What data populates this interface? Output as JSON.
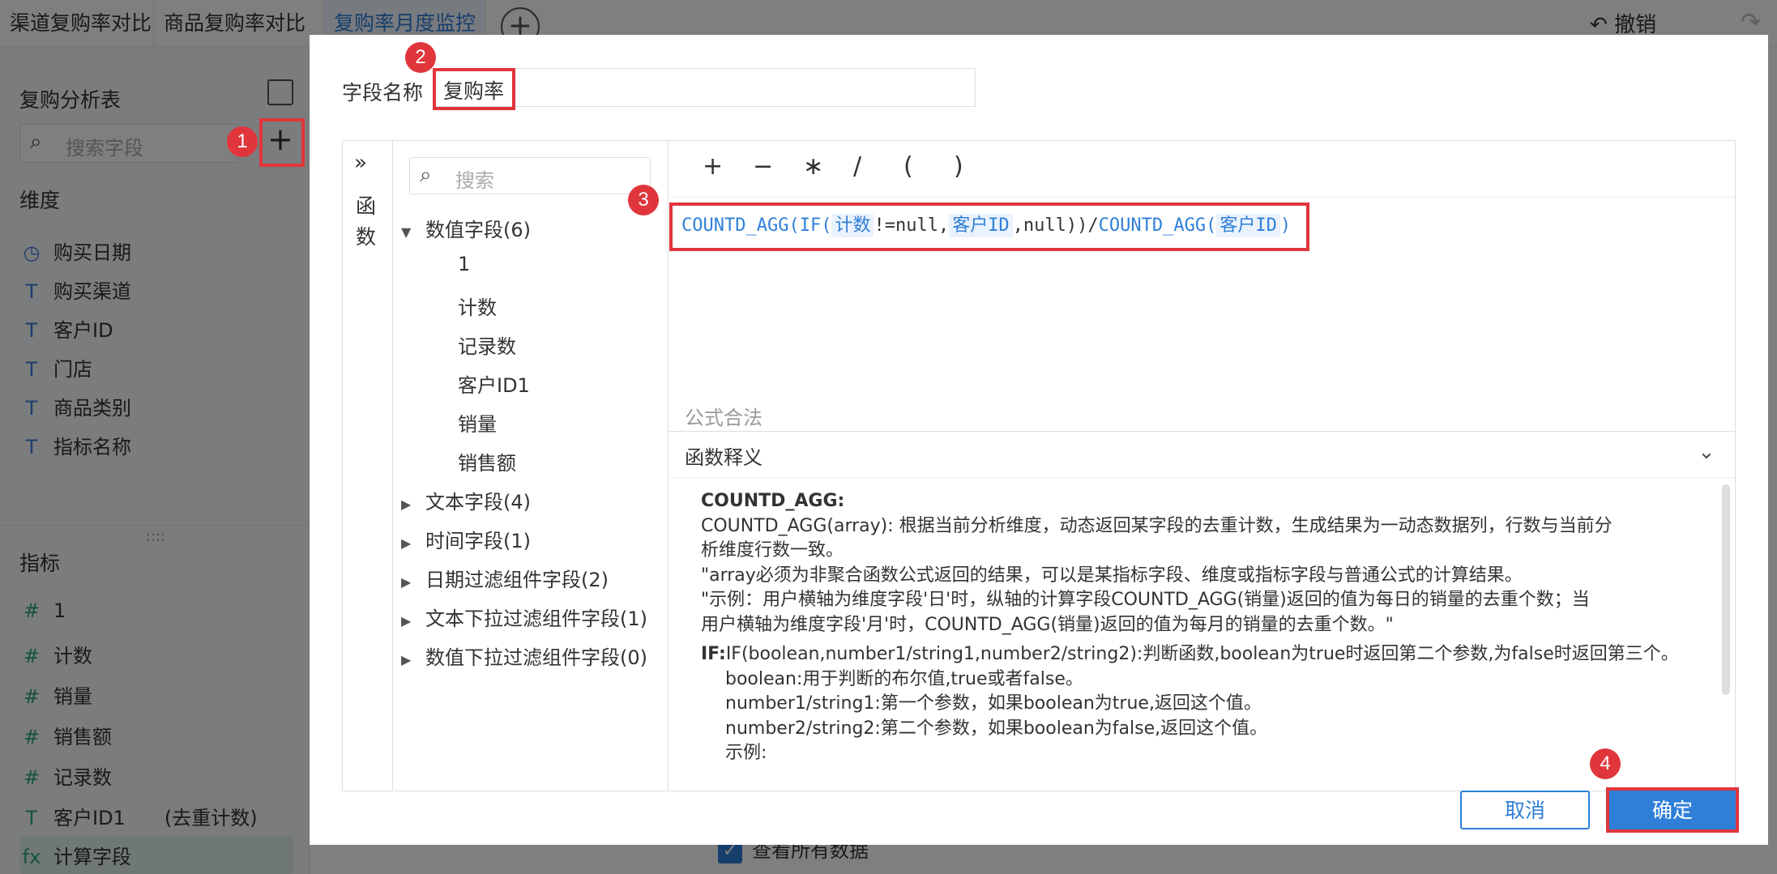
{
  "tabs": [
    "渠道复购率对比",
    "商品复购率对比",
    "复购率月度监控"
  ],
  "toolbar": {
    "undo_label": "撤销"
  },
  "sidebar": {
    "table_name": "复购分析表",
    "search_placeholder": "搜索字段",
    "dimension_title": "维度",
    "dimensions": [
      "购买日期",
      "购买渠道",
      "客户ID",
      "门店",
      "商品类别",
      "指标名称"
    ],
    "measure_title": "指标",
    "measures": [
      "1",
      "计数",
      "销量",
      "销售额",
      "记录数",
      "客户ID1",
      "计算字段"
    ],
    "measure_extra": "(去重计数)"
  },
  "background": {
    "check_all_label": "查看所有数据"
  },
  "dialog": {
    "field_name_label": "字段名称",
    "field_name_value": "复购率",
    "func_panel_label": "函数",
    "field_search_placeholder": "搜索",
    "tree": [
      {
        "label": "数值字段(6)",
        "expanded": true
      },
      {
        "label": "1"
      },
      {
        "label": "计数"
      },
      {
        "label": "记录数"
      },
      {
        "label": "客户ID1"
      },
      {
        "label": "销量"
      },
      {
        "label": "销售额"
      },
      {
        "label": "文本字段(4)",
        "expanded": false
      },
      {
        "label": "时间字段(1)",
        "expanded": false
      },
      {
        "label": "日期过滤组件字段(2)",
        "expanded": false
      },
      {
        "label": "文本下拉过滤组件字段(1)",
        "expanded": false
      },
      {
        "label": "数值下拉过滤组件字段(0)",
        "expanded": false
      }
    ],
    "operators": [
      "+",
      "−",
      "∗",
      "/",
      "(",
      ")"
    ],
    "formula": {
      "f1": "COUNTD_AGG(",
      "f2": "IF(",
      "field1": "计数",
      "f3": "!=null,",
      "field2": "客户ID",
      "f4": ",null))/",
      "f5": "COUNTD_AGG(",
      "field3": "客户ID",
      "f6": ")"
    },
    "formula_status": "公式合法",
    "desc_title": "函数释义",
    "desc_lines": [
      "COUNTD_AGG:",
      "COUNTD_AGG(array): 根据当前分析维度，动态返回某字段的去重计数，生成结果为一动态数据列，行数与当前分",
      "析维度行数一致。",
      " \"array必须为非聚合函数公式返回的结果，可以是某指标字段、维度或指标字段与普通公式的计算结果。",
      " \"示例：用户横轴为维度字段'日'时，纵轴的计算字段COUNTD_AGG(销量)返回的值为每日的销量的去重个数；当",
      "用户横轴为维度字段'月'时，COUNTD_AGG(销量)返回的值为每月的销量的去重个数。\"",
      "IF:",
      "IF(boolean,number1/string1,number2/string2):判断函数,boolean为true时返回第二个参数,为false时返回第三个。",
      "boolean:用于判断的布尔值,true或者false。",
      "number1/string1:第一个参数，如果boolean为true,返回这个值。",
      "number2/string2:第二个参数，如果boolean为false,返回这个值。",
      "示例:"
    ],
    "cancel_label": "取消",
    "ok_label": "确定"
  },
  "annotations": [
    "1",
    "2",
    "3",
    "4"
  ],
  "colors": {
    "accent": "#2f7fd8",
    "annotation": "#e0353b",
    "green_icon": "#2ba57c"
  }
}
